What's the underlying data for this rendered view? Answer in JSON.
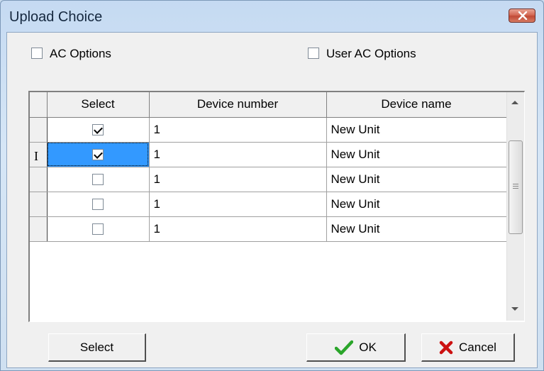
{
  "window": {
    "title": "Upload Choice"
  },
  "options": {
    "ac_options": {
      "label": "AC Options",
      "checked": false
    },
    "user_ac_options": {
      "label": "User AC Options",
      "checked": false
    }
  },
  "grid": {
    "columns": [
      "Select",
      "Device number",
      "Device name"
    ],
    "rows": [
      {
        "selected": true,
        "device_number": "1",
        "device_name": "New Unit"
      },
      {
        "selected": true,
        "device_number": "1",
        "device_name": "New Unit",
        "current": true
      },
      {
        "selected": false,
        "device_number": "1",
        "device_name": "New Unit"
      },
      {
        "selected": false,
        "device_number": "1",
        "device_name": "New Unit"
      },
      {
        "selected": false,
        "device_number": "1",
        "device_name": "New Unit"
      }
    ],
    "current_row_marker": "I"
  },
  "buttons": {
    "select_label": "Select",
    "ok_label": "OK",
    "cancel_label": "Cancel"
  },
  "colors": {
    "selection": "#3399ff",
    "ok_icon": "#2aa52a",
    "cancel_icon": "#cc1111"
  },
  "icons": {
    "close": "close-icon",
    "ok": "checkmark-icon",
    "cancel": "cross-icon"
  }
}
